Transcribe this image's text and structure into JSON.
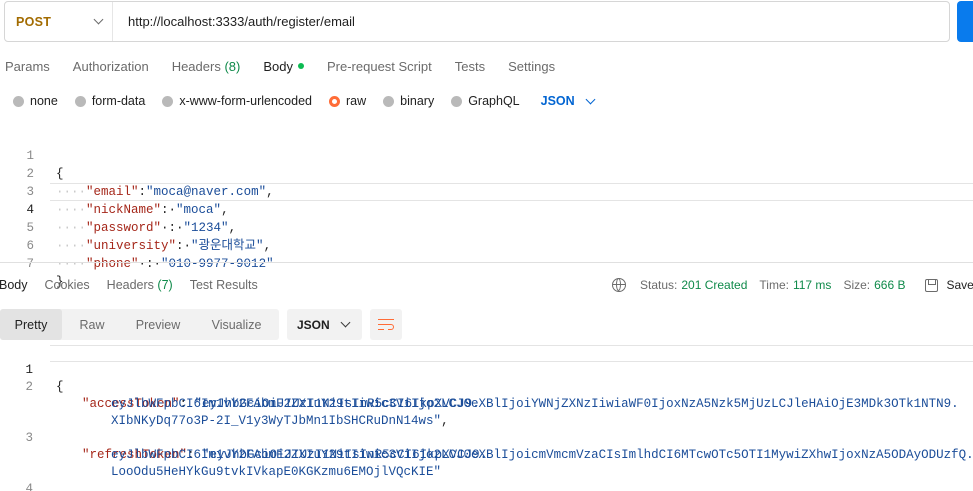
{
  "request": {
    "method": "POST",
    "url": "http://localhost:3333/auth/register/email"
  },
  "request_tabs": {
    "params": "Params",
    "authorization": "Authorization",
    "headers": "Headers",
    "headers_count": "(8)",
    "body": "Body",
    "pre_request": "Pre-request Script",
    "tests": "Tests",
    "settings": "Settings"
  },
  "body_types": {
    "none": "none",
    "form_data": "form-data",
    "urlencoded": "x-www-form-urlencoded",
    "raw": "raw",
    "binary": "binary",
    "graphql": "GraphQL",
    "selected": "raw",
    "language": "JSON"
  },
  "request_body": {
    "line_numbers": [
      "1",
      "2",
      "3",
      "4",
      "5",
      "6",
      "7"
    ],
    "open": "{",
    "close": "}",
    "ind": "····",
    "fields": [
      {
        "key": "\"email\"",
        "sep": ":",
        "value": "\"moca@naver.com\"",
        "end": ","
      },
      {
        "key": "\"nickName\"",
        "sep": ":·",
        "value": "\"moca\"",
        "end": ","
      },
      {
        "key": "\"password\"",
        "sep": "·:·",
        "value": "\"1234\"",
        "end": ","
      },
      {
        "key": "\"university\"",
        "sep": ":·",
        "value": "\"광운대학교\"",
        "end": ","
      },
      {
        "key": "\"phone\"",
        "sep": "·:·",
        "value": "\"010-9977-9012\"",
        "end": ""
      }
    ]
  },
  "response_tabs": {
    "body": "Body",
    "cookies": "Cookies",
    "headers": "Headers",
    "headers_count": "(7)",
    "test_results": "Test Results"
  },
  "status": {
    "status_label": "Status:",
    "status_value": "201 Created",
    "time_label": "Time:",
    "time_value": "117 ms",
    "size_label": "Size:",
    "size_value": "666 B",
    "save_label": "Save a"
  },
  "response_toolbar": {
    "pretty": "Pretty",
    "raw": "Raw",
    "preview": "Preview",
    "visualize": "Visualize",
    "format": "JSON"
  },
  "response_body": {
    "ln1": "1",
    "ln2": "2",
    "ln3": "3",
    "ln4": "4",
    "open": "{",
    "close": "}",
    "access_key": "\"accessToken\"",
    "access_l1": "\"eyJhbGciOiJIUzI1NiIsInR5cCI6IkpXVCJ9.",
    "access_l2": "eyJlbWFpbCI6Im1vY2FAbmF2ZXIuY29tIiwic3ViIjo2LCJ0eXBlIjoiYWNjZXNzIiwiaWF0IjoxNzA5Nzk5MjUzLCJleHAiOjE3MDk3OTk1NTN9.",
    "access_l3": "XIbNKyDq77o3P-2I_V1y3WyTJbMn1IbSHCRuDnN14ws\"",
    "refresh_key": "\"refreshToken\"",
    "refresh_l1": "\"eyJhbGciOiJIUzI1NiIsInR5cCI6IkpXVCJ9.",
    "refresh_l2": "eyJlbWFpbCI6Im1vY2FAbmF2ZXIuY29tIiwic3ViIjo2LCJ0eXBlIjoicmVmcmVzaCIsImlhdCI6MTcwOTc5OTI1MywiZXhwIjoxNzA5ODAyODUzfQ.",
    "refresh_l3": "LooOdu5HeHYkGu9tvkIVkapE0KGKzmu6EMOjlVQcKIE\""
  },
  "colors": {
    "method": "#a26b00",
    "accent_orange": "#ff6c37",
    "status_green": "#0f8a4a",
    "link_blue": "#0265d2",
    "json_key": "#a5271a",
    "json_string": "#1b4d99"
  }
}
